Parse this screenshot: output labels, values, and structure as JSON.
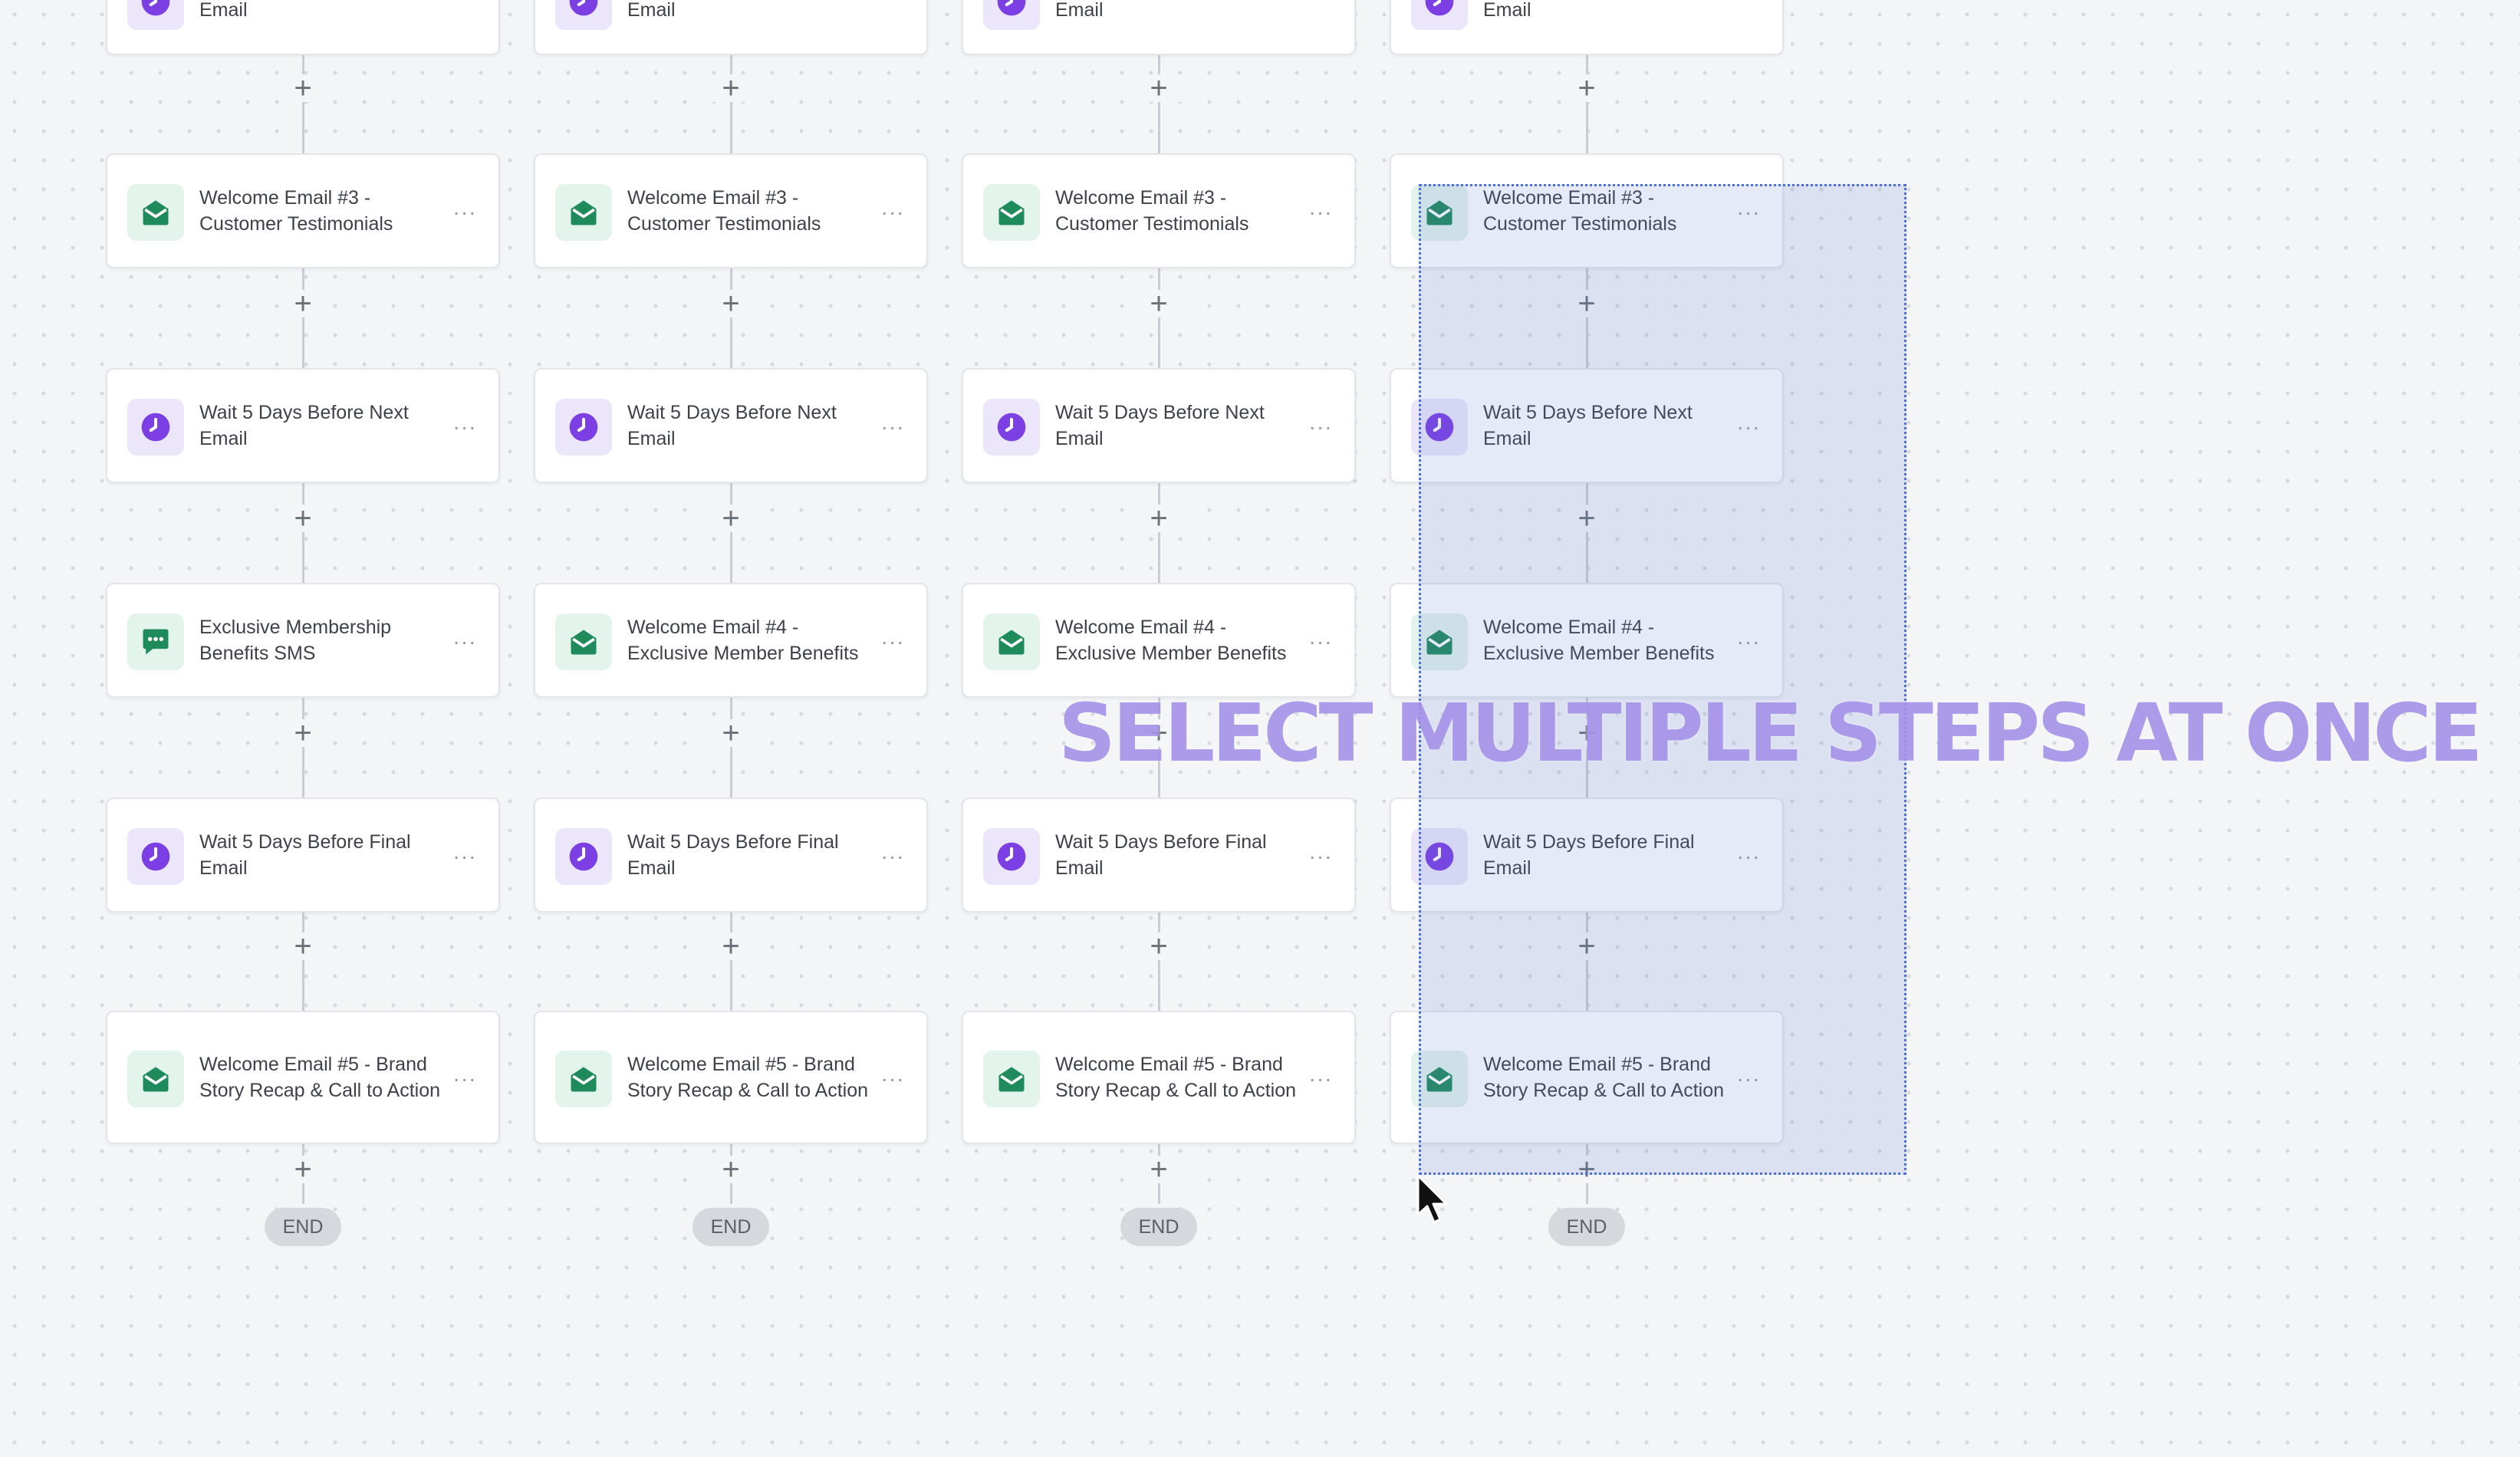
{
  "caption": "SELECT MULTIPLE STEPS AT ONCE",
  "colors": {
    "clock_icon": "#7b3fe4",
    "email_icon": "#1f8a5b",
    "sms_icon": "#1f8a5b",
    "selection": "#4d6fd6"
  },
  "end_label": "END",
  "add_symbol": "+",
  "more_symbol": "···",
  "columns": [
    {
      "steps": [
        {
          "icon": "clock-icon",
          "label": "Email"
        },
        {
          "icon": "email-icon",
          "label": "Welcome Email #3 - Customer Testimonials"
        },
        {
          "icon": "clock-icon",
          "label": "Wait 5 Days Before Next Email"
        },
        {
          "icon": "sms-icon",
          "label": "Exclusive Membership Benefits SMS"
        },
        {
          "icon": "clock-icon",
          "label": "Wait 5 Days Before Final Email"
        },
        {
          "icon": "email-icon",
          "label": "Welcome Email #5 - Brand Story Recap & Call to Action"
        }
      ]
    },
    {
      "steps": [
        {
          "icon": "clock-icon",
          "label": "Email"
        },
        {
          "icon": "email-icon",
          "label": "Welcome Email #3 - Customer Testimonials"
        },
        {
          "icon": "clock-icon",
          "label": "Wait 5 Days Before Next Email"
        },
        {
          "icon": "email-icon",
          "label": "Welcome Email #4 - Exclusive Member Benefits"
        },
        {
          "icon": "clock-icon",
          "label": "Wait 5 Days Before Final Email"
        },
        {
          "icon": "email-icon",
          "label": "Welcome Email #5 - Brand Story Recap & Call to Action"
        }
      ]
    },
    {
      "steps": [
        {
          "icon": "clock-icon",
          "label": "Email"
        },
        {
          "icon": "email-icon",
          "label": "Welcome Email #3 - Customer Testimonials"
        },
        {
          "icon": "clock-icon",
          "label": "Wait 5 Days Before Next Email"
        },
        {
          "icon": "email-icon",
          "label": "Welcome Email #4 - Exclusive Member Benefits"
        },
        {
          "icon": "clock-icon",
          "label": "Wait 5 Days Before Final Email"
        },
        {
          "icon": "email-icon",
          "label": "Welcome Email #5 - Brand Story Recap & Call to Action"
        }
      ]
    },
    {
      "steps": [
        {
          "icon": "clock-icon",
          "label": "Email"
        },
        {
          "icon": "email-icon",
          "label": "Welcome Email #3 - Customer Testimonials"
        },
        {
          "icon": "clock-icon",
          "label": "Wait 5 Days Before Next Email"
        },
        {
          "icon": "email-icon",
          "label": "Welcome Email #4 - Exclusive Member Benefits"
        },
        {
          "icon": "clock-icon",
          "label": "Wait 5 Days Before Final Email"
        },
        {
          "icon": "email-icon",
          "label": "Welcome Email #5 - Brand Story Recap & Call to Action"
        }
      ]
    }
  ]
}
